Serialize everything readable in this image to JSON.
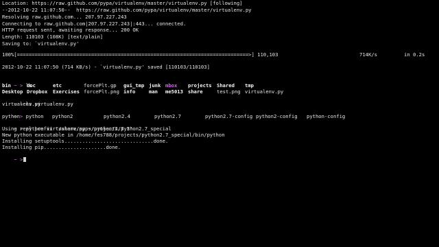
{
  "colors": {
    "background": "#000000",
    "text": "#e6e6e6",
    "prompt": "#d27de0",
    "highlight_dir": "#c86bdc"
  },
  "wget": {
    "location": "Location: https://raw.github.com/pypa/virtualenv/master/virtualenv.py [following]",
    "datetime_url": "--2012-10-22 11:07:50--  https://raw.github.com/pypa/virtualenv/master/virtualenv.py",
    "resolving": "Resolving raw.github.com... 207.97.227.243",
    "connecting": "Connecting to raw.github.com|207.97.227.243|:443... connected.",
    "http": "HTTP request sent, awaiting response... 200 OK",
    "length": "Length: 110103 (108K) [text/plain]",
    "saving": "Saving to: `virtualenv.py'",
    "progress_bar": "100%[==============================================================================>] 110,103",
    "progress_percent": 100,
    "speed": "714K/s",
    "time": "in 0.2s",
    "saved": "2012-10-22 11:07:50 (714 KB/s) - `virtualenv.py' saved [110103/110103]"
  },
  "prompt_symbol": "~ >",
  "commands": {
    "ls": " ls",
    "ls_venv": " ls virtualenv.py",
    "python": " python",
    "python_venv": " python virtualenv.py ~/projects/python2.7_special",
    "final": ""
  },
  "ls_output": {
    "row1": [
      "bin",
      "doc",
      "etc",
      "forcePlt.gp",
      "gui_tmp",
      "junk",
      "mbox",
      "projects",
      "Shared",
      "tmp"
    ],
    "row2": [
      "Desktop",
      "Dropbox",
      "Exercises",
      "forcePlt.png",
      "info",
      "man",
      "me5013",
      "share",
      "test.png",
      "virtualenv.py"
    ]
  },
  "ls_venv_output": "virtualenv.py",
  "python_completions": [
    "python",
    "python2",
    "python2.4",
    "python2.7",
    "python2.7-config",
    "python2-config",
    "python-config"
  ],
  "venv_output": {
    "prefix": "Using real prefix '/share/apps/python/2.7.3'",
    "executable": "New python executable in /home/fes788/projects/python2.7_special/bin/python",
    "setuptools": "Installing setuptools..............................done.",
    "pip": "Installing pip.....................done."
  }
}
